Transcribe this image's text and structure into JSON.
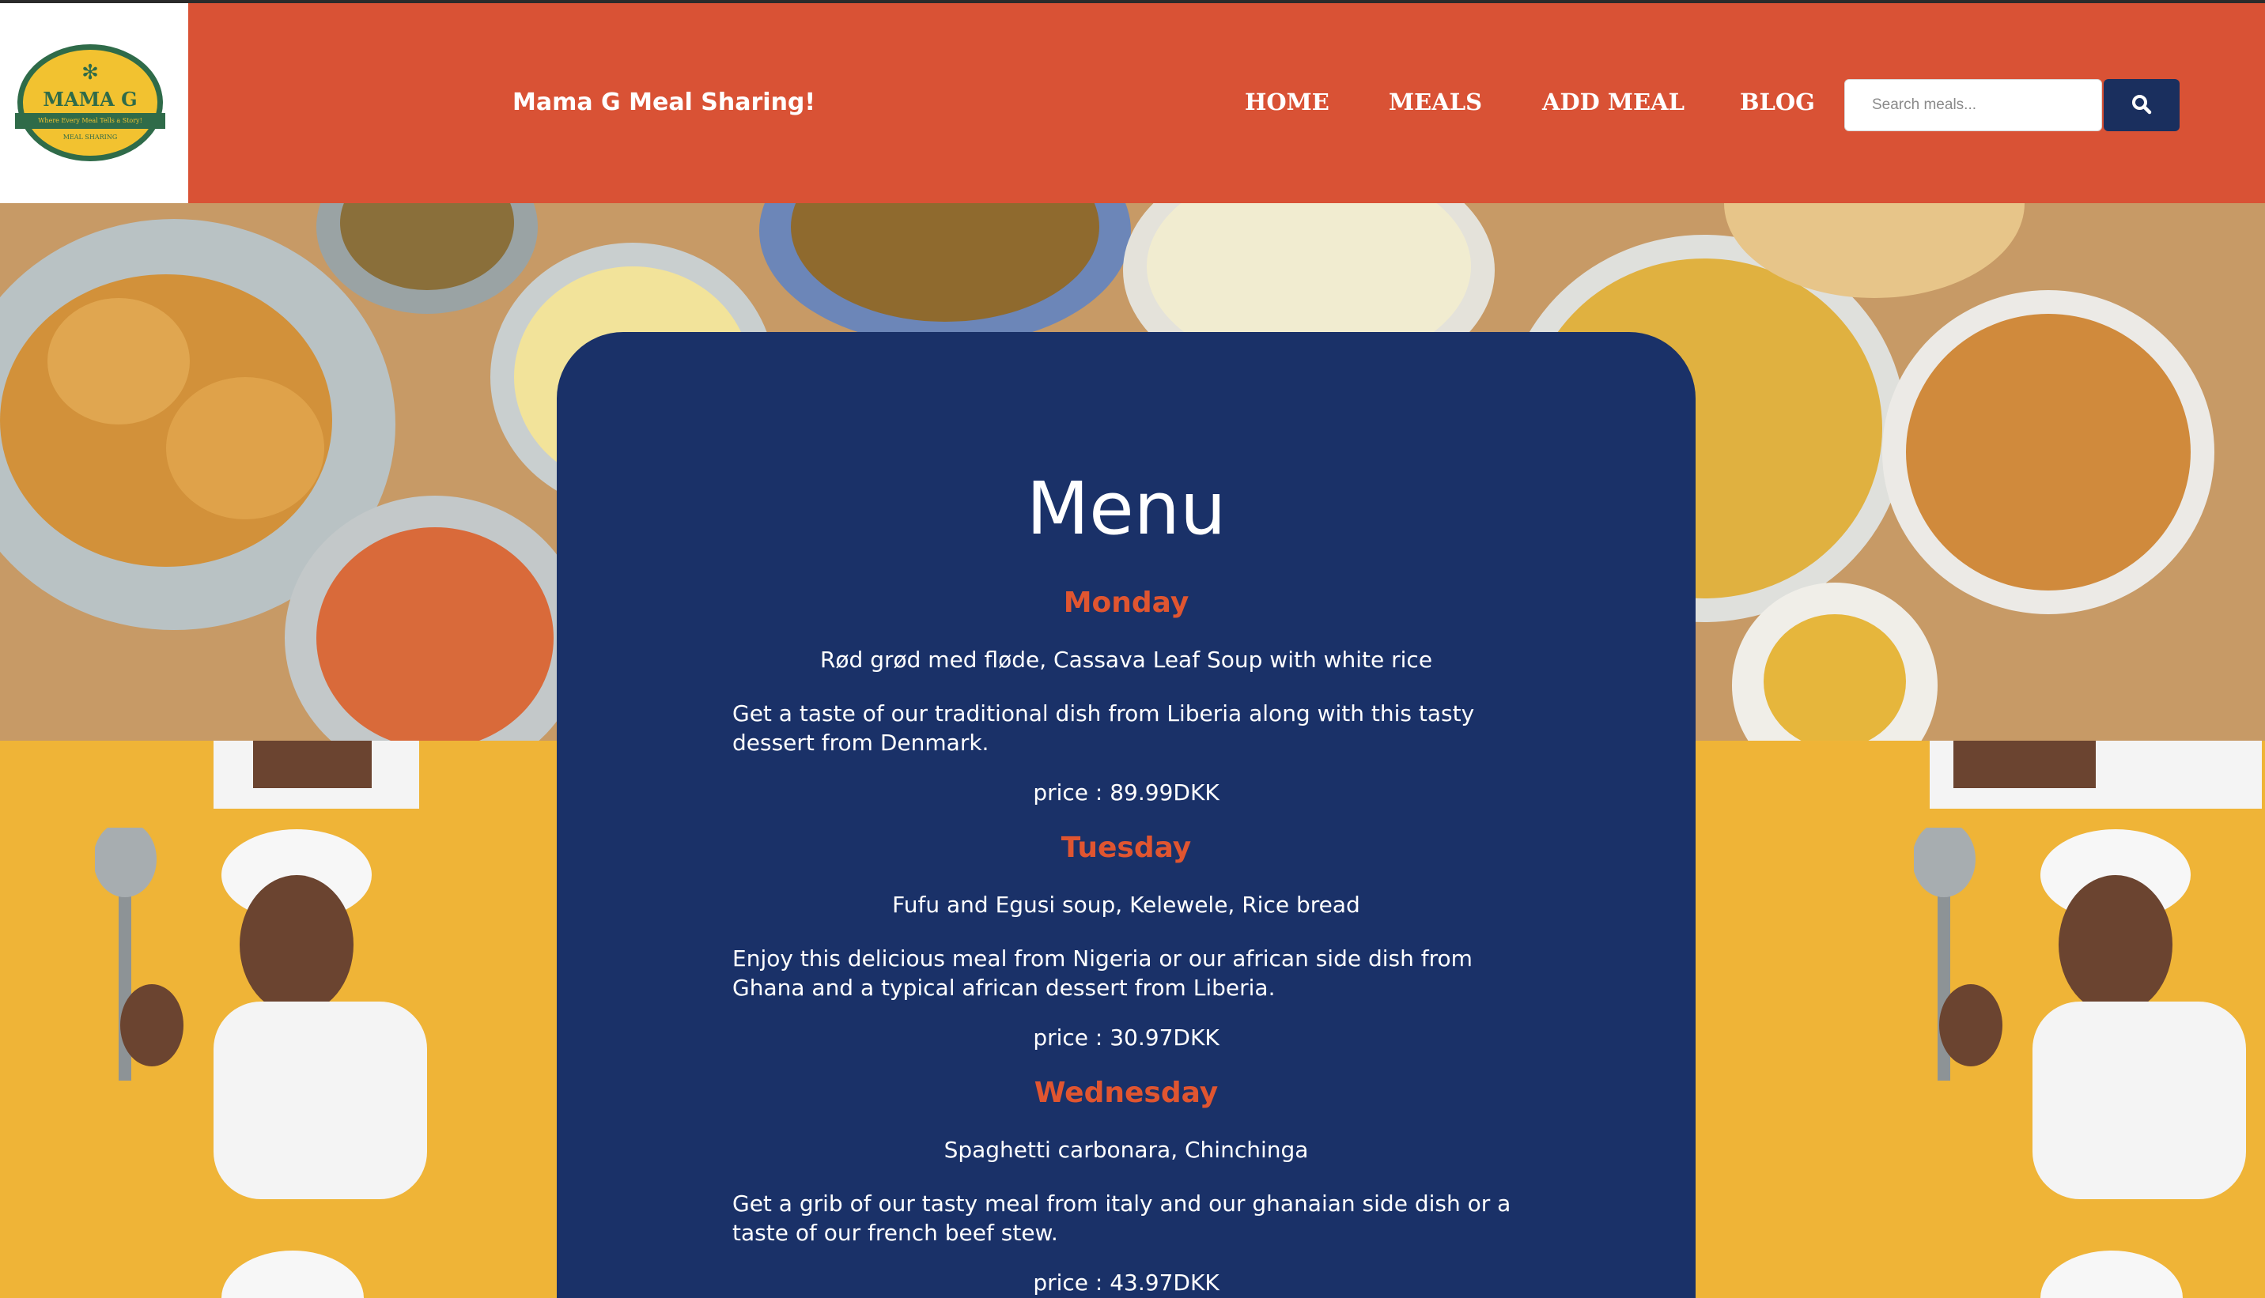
{
  "header": {
    "logo": {
      "name": "MAMA G",
      "tagline": "Where Every Meal Tells a Story!",
      "sub": "MEAL SHARING"
    },
    "brand": "Mama G Meal Sharing!",
    "nav": [
      "HOME",
      "MEALS",
      "ADD MEAL",
      "BLOG"
    ],
    "search": {
      "placeholder": "Search meals..."
    }
  },
  "colors": {
    "header_bg": "#d95235",
    "panel_bg": "#1a3168",
    "day_heading": "#e05530",
    "search_button": "#1a2f5e",
    "chef_bg": "#efb437"
  },
  "icons": {
    "search": "search-icon",
    "logo": "palm-icon"
  },
  "menu": {
    "title": "Menu",
    "days": [
      {
        "day": "Monday",
        "dishes": "Rød grød med fløde, Cassava Leaf Soup with white rice",
        "description": "Get a taste of our traditional dish from Liberia along with this tasty dessert from Denmark.",
        "price": "price : 89.99DKK"
      },
      {
        "day": "Tuesday",
        "dishes": "Fufu and Egusi soup, Kelewele, Rice bread",
        "description": "Enjoy this delicious meal from Nigeria or our african side dish from Ghana and a typical african dessert from Liberia.",
        "price": "price : 30.97DKK"
      },
      {
        "day": "Wednesday",
        "dishes": "Spaghetti carbonara, Chinchinga",
        "description": "Get a grib of our tasty meal from italy and our ghanaian side dish or a taste of our french beef stew.",
        "price": "price : 43.97DKK"
      }
    ]
  }
}
